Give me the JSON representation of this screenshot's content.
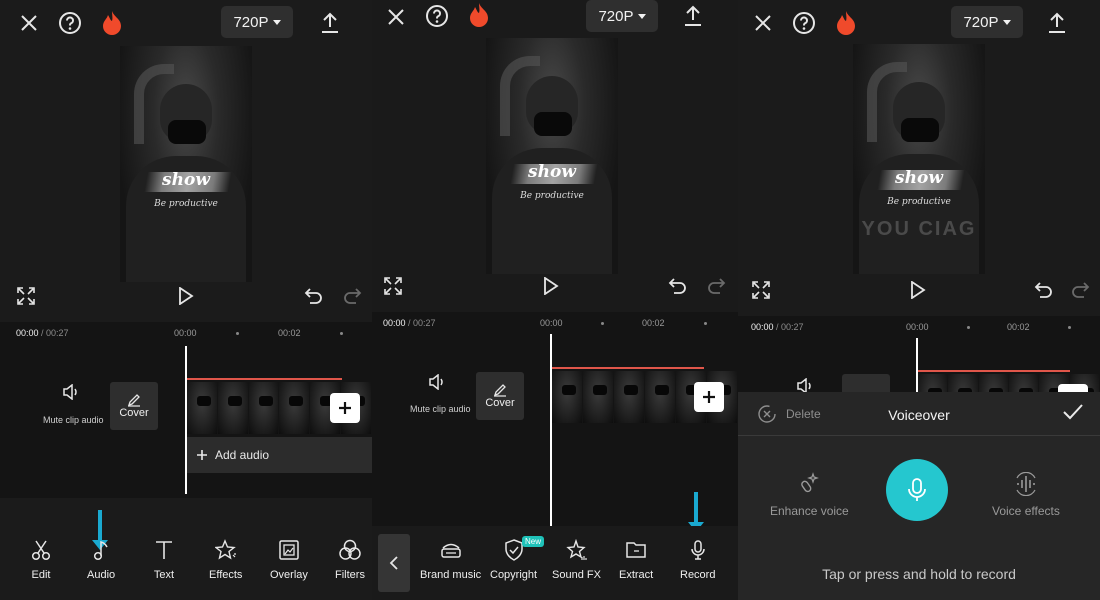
{
  "resolution": "720P",
  "preview": {
    "overlay_title": "show",
    "overlay_subtitle": "Be productive",
    "logo_text": "YOU CIAG"
  },
  "timeline": {
    "current": "00:00",
    "total": " / 00:27",
    "ticks": [
      "00:00",
      "00:02"
    ]
  },
  "mute_label": "Mute clip audio",
  "cover_label": "Cover",
  "add_audio_label": "Add audio",
  "main_toolbar": [
    {
      "label": "Edit",
      "icon": "scissors-icon"
    },
    {
      "label": "Audio",
      "icon": "music-note-icon"
    },
    {
      "label": "Text",
      "icon": "text-icon"
    },
    {
      "label": "Effects",
      "icon": "sparkle-icon"
    },
    {
      "label": "Overlay",
      "icon": "overlay-icon"
    },
    {
      "label": "Filters",
      "icon": "filters-icon"
    }
  ],
  "audio_toolbar": [
    {
      "label": "Brand music",
      "icon": "brand-music-icon"
    },
    {
      "label": "Copyright",
      "icon": "shield-check-icon"
    },
    {
      "label": "Sound FX",
      "icon": "sound-fx-icon"
    },
    {
      "label": "Extract",
      "icon": "folder-icon"
    },
    {
      "label": "Record",
      "icon": "microphone-icon"
    }
  ],
  "new_badge": "New",
  "voiceover": {
    "title": "Voiceover",
    "delete_label": "Delete",
    "enhance_label": "Enhance voice",
    "effects_label": "Voice effects",
    "hint": "Tap or press and hold to record"
  },
  "colors": {
    "accent": "#25c7cf",
    "arrow": "#1aa9d0",
    "flame": "#f04a2b",
    "track_red": "#e0564a"
  }
}
